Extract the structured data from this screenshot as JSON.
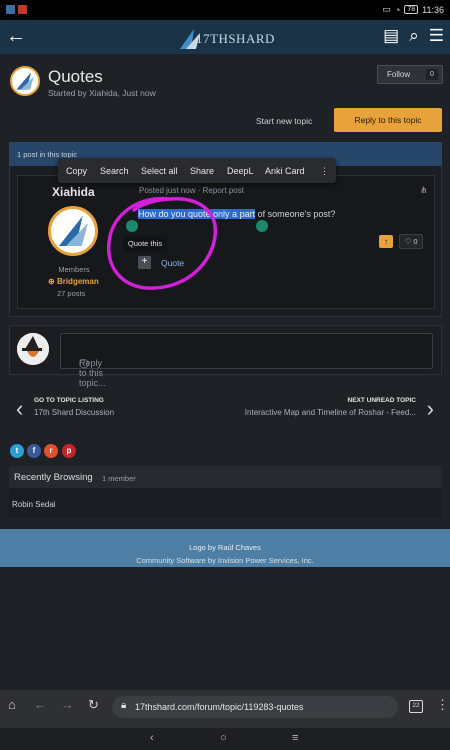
{
  "status": {
    "time": "11:36",
    "battery": "78"
  },
  "site": {
    "logo_text": "17THSHARD"
  },
  "topic": {
    "title": "Quotes",
    "started_by": "Started by Xiahida, Just now"
  },
  "follow": {
    "label": "Follow",
    "count": "0"
  },
  "actions": {
    "start_new": "Start new topic",
    "reply": "Reply to this topic"
  },
  "panel": {
    "header": "1 post in this topic"
  },
  "context_menu": {
    "items": [
      "Copy",
      "Search",
      "Select all",
      "Share",
      "DeepL",
      "Anki Card"
    ]
  },
  "post": {
    "author": "Xiahida",
    "meta": "Posted just now · Report post",
    "text_selected": "How do you quote only a part",
    "text_rest": " of someone's post?",
    "role": "Members",
    "rank": "Bridgeman",
    "posts": "27 posts",
    "likes": "0",
    "tooltip": "Quote this",
    "quote_label": "Quote"
  },
  "reply_box": {
    "placeholder": "Reply to this topic..."
  },
  "nav": {
    "prev_label": "GO TO TOPIC LISTING",
    "prev_value": "17th Shard Discussion",
    "next_label": "NEXT UNREAD TOPIC",
    "next_value": "Interactive Map and Timeline of Roshar - Feed..."
  },
  "browsing": {
    "title": "Recently Browsing",
    "count": "1 member",
    "member": "Robin Sedai"
  },
  "footer": {
    "line1": "Logo by Raúl Chaves",
    "line2": "Community Software by Invision Power Services, Inc."
  },
  "browser": {
    "url": "17thshard.com/forum/topic/119283-quotes",
    "tab_count": "22"
  },
  "colors": {
    "accent": "#e7a33a",
    "header_bg": "#1b3346",
    "panel_head": "#27476a",
    "selection": "#2d6bd0",
    "annotation": "#d21fd8"
  }
}
